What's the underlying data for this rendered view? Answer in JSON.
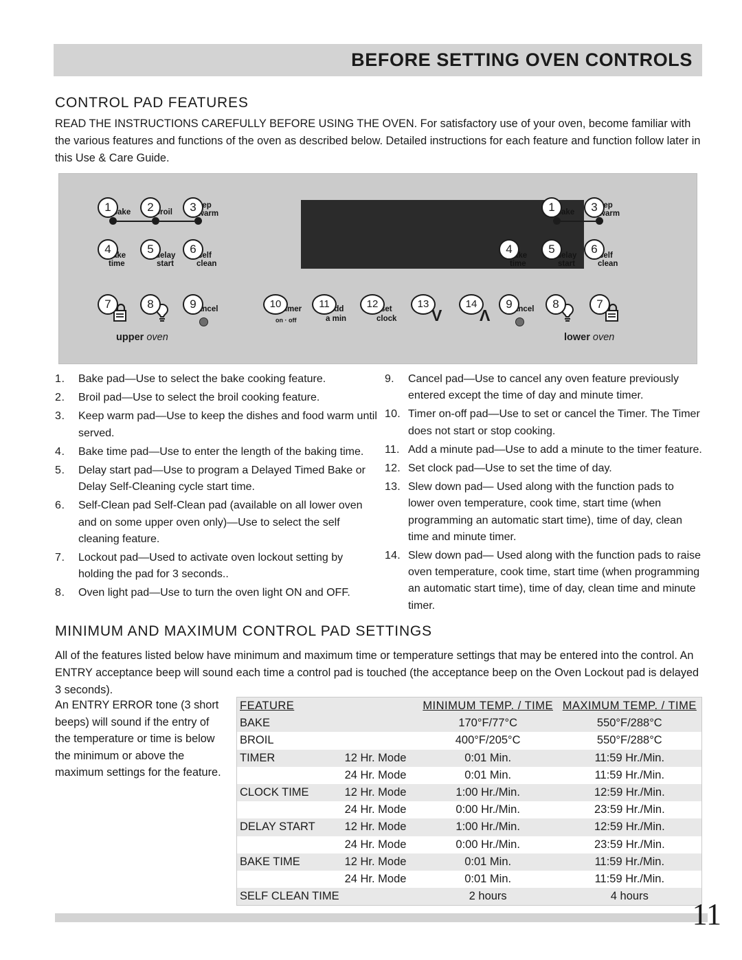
{
  "header": {
    "title": "BEFORE SETTING OVEN CONTROLS"
  },
  "sections": {
    "control_pad_features_heading": "CONTROL PAD FEATURES",
    "control_pad_features_intro": "READ THE INSTRUCTIONS CAREFULLY BEFORE USING THE OVEN. For satisfactory use of your oven, become familiar with the various features and functions of the oven as described below. Detailed instructions for each feature and function follow later in this Use & Care Guide.",
    "minmax_heading": "MINIMUM AND MAXIMUM CONTROL PAD SETTINGS",
    "minmax_intro": "All of the features listed below have minimum and maximum time or temperature settings that may be entered into the control. An ENTRY acceptance beep will sound each time a control pad is touched (the acceptance beep on the Oven Lockout pad is delayed 3 seconds).",
    "entry_error_note": "An ENTRY ERROR tone (3 short beeps) will sound if the entry of the temperature or time is below the minimum or above the maximum settings for the feature."
  },
  "panel": {
    "upper_oven_label_bold": "upper",
    "upper_oven_label_rest": "oven",
    "lower_oven_label_bold": "lower",
    "lower_oven_label_rest": "oven",
    "pads": {
      "bake": "bake",
      "broil": "broil",
      "keep": "eep",
      "warm": "warm",
      "bake2": "ake",
      "time": "time",
      "delay": "delay",
      "start": "start",
      "self": "self",
      "clean": "clean",
      "cancel": "ancel",
      "timer": "timer",
      "timer_onoff": "on · off",
      "add": "add",
      "a_min": "a min",
      "set": "set",
      "clock": "clock",
      "slew_down": "V",
      "slew_up": "Λ"
    },
    "numbers": {
      "n1": "1",
      "n2": "2",
      "n3": "3",
      "n4": "4",
      "n5": "5",
      "n6": "6",
      "n7": "7",
      "n8": "8",
      "n9": "9",
      "n10": "10",
      "n11": "11",
      "n12": "12",
      "n13": "13",
      "n14": "14"
    }
  },
  "features_left": [
    {
      "num": "1.",
      "text": "Bake pad—Use to select the bake cooking feature."
    },
    {
      "num": "2.",
      "text": "Broil pad—Use to select the broil cooking feature."
    },
    {
      "num": "3.",
      "text": "Keep warm pad—Use to keep the dishes and food warm until served."
    },
    {
      "num": "4.",
      "text": "Bake time pad—Use to enter the length of the baking time."
    },
    {
      "num": "5.",
      "text": "Delay start pad—Use to program a Delayed Timed Bake or Delay Self-Cleaning cycle start time."
    },
    {
      "num": "6.",
      "text": "Self-Clean pad Self-Clean pad (available on all lower oven and on some upper oven only)—Use to select the self cleaning feature."
    },
    {
      "num": "7.",
      "text": "Lockout pad—Used to activate oven lockout setting by holding the pad for 3 seconds.."
    },
    {
      "num": "8.",
      "text": "Oven light pad—Use to turn the oven light ON and OFF."
    }
  ],
  "features_right": [
    {
      "num": "9.",
      "text": "Cancel pad—Use to cancel any oven feature previously entered except the time of day and minute timer."
    },
    {
      "num": "10.",
      "text": "Timer on-off pad—Use to set or cancel the Timer. The Timer does not start or stop cooking."
    },
    {
      "num": "11.",
      "text": "Add a minute pad—Use to add a minute to the timer feature."
    },
    {
      "num": "12.",
      "text": "Set clock pad—Use to set the time of day."
    },
    {
      "num": "13.",
      "text": "Slew down pad— Used along with the function pads to lower oven temperature, cook time, start time (when programming an automatic start time), time of day, clean time and minute timer."
    },
    {
      "num": "14.",
      "text": "Slew down pad— Used along with the function pads to raise oven temperature, cook time, start time (when programming an automatic start time), time of day, clean time and minute timer."
    }
  ],
  "table": {
    "headers": [
      "FEATURE",
      "",
      "MINIMUM TEMP. / TIME",
      "MAXIMUM TEMP. / TIME"
    ],
    "rows": [
      {
        "feature": "BAKE",
        "mode": "",
        "min": "170°F/77°C",
        "max": "550°F/288°C",
        "shade": true
      },
      {
        "feature": "BROIL",
        "mode": "",
        "min": "400°F/205°C",
        "max": "550°F/288°C",
        "shade": false
      },
      {
        "feature": "TIMER",
        "mode": "12 Hr. Mode",
        "min": "0:01 Min.",
        "max": "11:59 Hr./Min.",
        "shade": true
      },
      {
        "feature": "",
        "mode": "24 Hr. Mode",
        "min": "0:01 Min.",
        "max": "11:59 Hr./Min.",
        "shade": false
      },
      {
        "feature": "CLOCK TIME",
        "mode": "12 Hr. Mode",
        "min": "1:00 Hr./Min.",
        "max": "12:59 Hr./Min.",
        "shade": true
      },
      {
        "feature": "",
        "mode": "24 Hr. Mode",
        "min": "0:00 Hr./Min.",
        "max": "23:59 Hr./Min.",
        "shade": false
      },
      {
        "feature": "DELAY START",
        "mode": "12 Hr. Mode",
        "min": "1:00 Hr./Min.",
        "max": "12:59 Hr./Min.",
        "shade": true
      },
      {
        "feature": "",
        "mode": "24 Hr. Mode",
        "min": "0:00 Hr./Min.",
        "max": "23:59 Hr./Min.",
        "shade": false
      },
      {
        "feature": "BAKE TIME",
        "mode": "12 Hr. Mode",
        "min": "0:01 Min.",
        "max": "11:59 Hr./Min.",
        "shade": true
      },
      {
        "feature": "",
        "mode": "24 Hr. Mode",
        "min": "0:01 Min.",
        "max": "11:59 Hr./Min.",
        "shade": false
      },
      {
        "feature": "SELF CLEAN TIME",
        "mode": "",
        "min": "2 hours",
        "max": "4 hours",
        "shade": true
      }
    ]
  },
  "footer": {
    "page_number": "11"
  },
  "colors": {
    "band": "#d3d3d3",
    "panel": "#cbcbcb",
    "display": "#2b2b2b",
    "table_shade": "#e8e8e8"
  }
}
